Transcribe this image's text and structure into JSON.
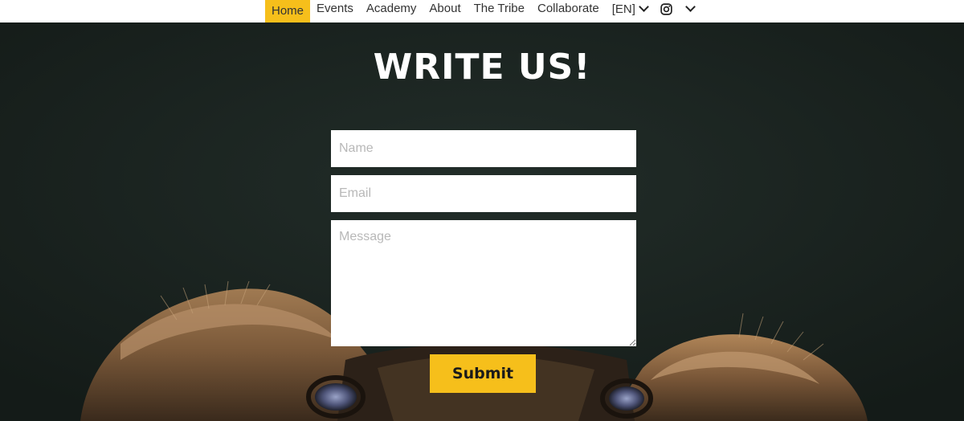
{
  "nav": {
    "items": [
      {
        "label": "Home"
      },
      {
        "label": "Events"
      },
      {
        "label": "Academy"
      },
      {
        "label": "About"
      },
      {
        "label": "The Tribe"
      },
      {
        "label": "Collaborate"
      }
    ],
    "language": "[EN]",
    "social_icon": "instagram-icon",
    "accent_color": "#f6bf1b"
  },
  "contact": {
    "title": "WRITE US!",
    "name_placeholder": "Name",
    "email_placeholder": "Email",
    "message_placeholder": "Message",
    "submit_label": "Submit"
  },
  "colors": {
    "background": "#1c2622",
    "button": "#f6bf1b"
  }
}
